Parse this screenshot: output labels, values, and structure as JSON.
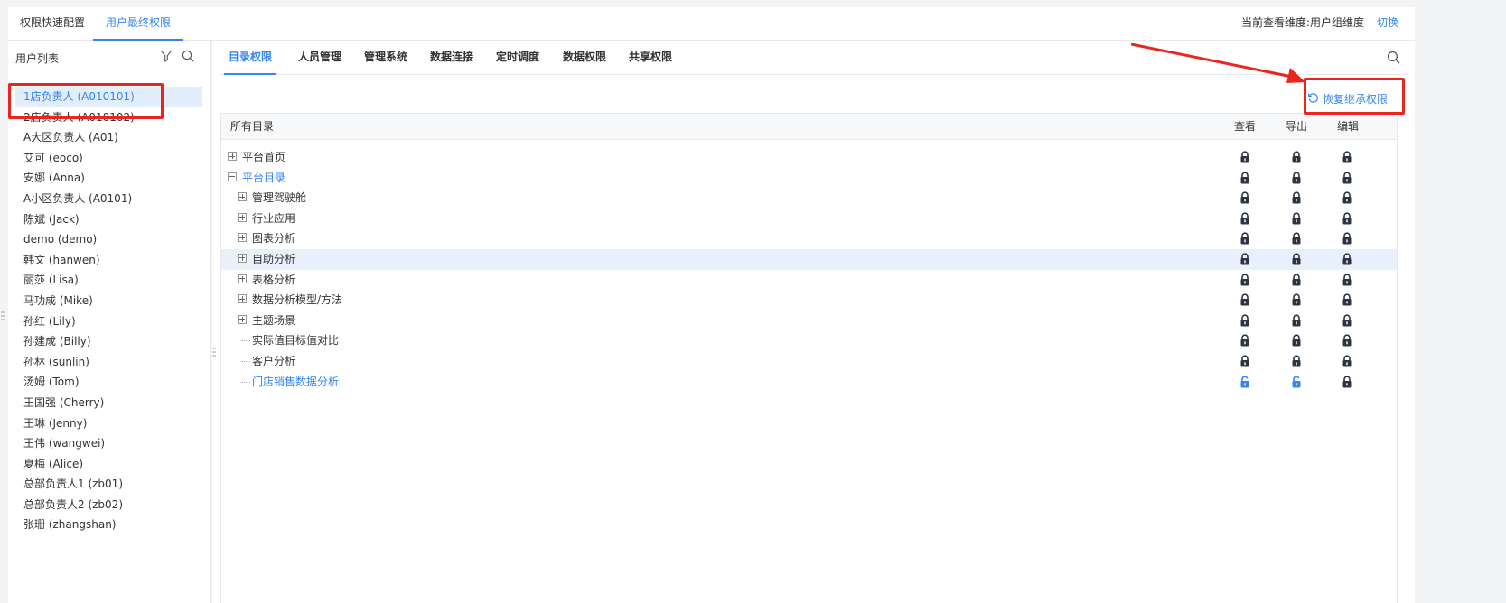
{
  "top_tabs": [
    {
      "label": "权限快速配置",
      "active": false
    },
    {
      "label": "用户最终权限",
      "active": true
    }
  ],
  "dimension_text": "当前查看维度:用户组维度",
  "switch_label": "切换",
  "left_panel": {
    "title": "用户列表",
    "users": [
      {
        "label": "1店负责人 (A010101)",
        "selected": true
      },
      {
        "label": "2店负责人 (A010102)"
      },
      {
        "label": "A大区负责人 (A01)"
      },
      {
        "label": "艾可 (eoco)"
      },
      {
        "label": "安娜 (Anna)"
      },
      {
        "label": "A小区负责人 (A0101)"
      },
      {
        "label": "陈斌 (Jack)"
      },
      {
        "label": "demo (demo)"
      },
      {
        "label": "韩文 (hanwen)"
      },
      {
        "label": "丽莎 (Lisa)"
      },
      {
        "label": "马功成 (Mike)"
      },
      {
        "label": "孙红 (Lily)"
      },
      {
        "label": "孙建成 (Billy)"
      },
      {
        "label": "孙林 (sunlin)"
      },
      {
        "label": "汤姆 (Tom)"
      },
      {
        "label": "王国强 (Cherry)"
      },
      {
        "label": "王琳 (Jenny)"
      },
      {
        "label": "王伟 (wangwei)"
      },
      {
        "label": "夏梅 (Alice)"
      },
      {
        "label": "总部负责人1 (zb01)"
      },
      {
        "label": "总部负责人2 (zb02)"
      },
      {
        "label": "张珊 (zhangshan)"
      }
    ]
  },
  "main_tabs": [
    {
      "label": "目录权限",
      "active": true
    },
    {
      "label": "人员管理"
    },
    {
      "label": "管理系统"
    },
    {
      "label": "数据连接"
    },
    {
      "label": "定时调度"
    },
    {
      "label": "数据权限"
    },
    {
      "label": "共享权限"
    }
  ],
  "restore_label": "恢复继承权限",
  "table": {
    "headers": {
      "name": "所有目录",
      "view": "查看",
      "export": "导出",
      "edit": "编辑"
    },
    "rows": [
      {
        "label": "平台首页",
        "level": 0,
        "toggle": "plus",
        "blue": false,
        "locks": [
          "locked",
          "locked",
          "locked"
        ]
      },
      {
        "label": "平台目录",
        "level": 0,
        "toggle": "minus",
        "blue": true,
        "locks": [
          "locked",
          "locked",
          "locked"
        ]
      },
      {
        "label": "管理驾驶舱",
        "level": 1,
        "toggle": "plus",
        "blue": false,
        "locks": [
          "locked",
          "locked",
          "locked"
        ]
      },
      {
        "label": "行业应用",
        "level": 1,
        "toggle": "plus",
        "blue": false,
        "locks": [
          "locked",
          "locked",
          "locked"
        ]
      },
      {
        "label": "图表分析",
        "level": 1,
        "toggle": "plus",
        "blue": false,
        "locks": [
          "locked",
          "locked",
          "locked"
        ]
      },
      {
        "label": "自助分析",
        "level": 1,
        "toggle": "plus",
        "blue": false,
        "highlight": true,
        "locks": [
          "locked",
          "locked",
          "locked"
        ]
      },
      {
        "label": "表格分析",
        "level": 1,
        "toggle": "plus",
        "blue": false,
        "locks": [
          "locked",
          "locked",
          "locked"
        ]
      },
      {
        "label": "数据分析模型/方法",
        "level": 1,
        "toggle": "plus",
        "blue": false,
        "locks": [
          "locked",
          "locked",
          "locked"
        ]
      },
      {
        "label": "主题场景",
        "level": 1,
        "toggle": "plus",
        "blue": false,
        "locks": [
          "locked",
          "locked",
          "locked"
        ]
      },
      {
        "label": "实际值目标值对比",
        "level": 1,
        "toggle": "none",
        "blue": false,
        "locks": [
          "locked",
          "locked",
          "locked"
        ]
      },
      {
        "label": "客户分析",
        "level": 1,
        "toggle": "none",
        "blue": false,
        "locks": [
          "locked",
          "locked",
          "locked"
        ]
      },
      {
        "label": "门店销售数据分析",
        "level": 1,
        "toggle": "none",
        "blue": true,
        "locks": [
          "unlocked",
          "unlocked",
          "locked"
        ]
      }
    ]
  },
  "colors": {
    "accent": "#3685f2",
    "annotation_red": "#e8261d",
    "lock_dark": "#2b3440"
  }
}
